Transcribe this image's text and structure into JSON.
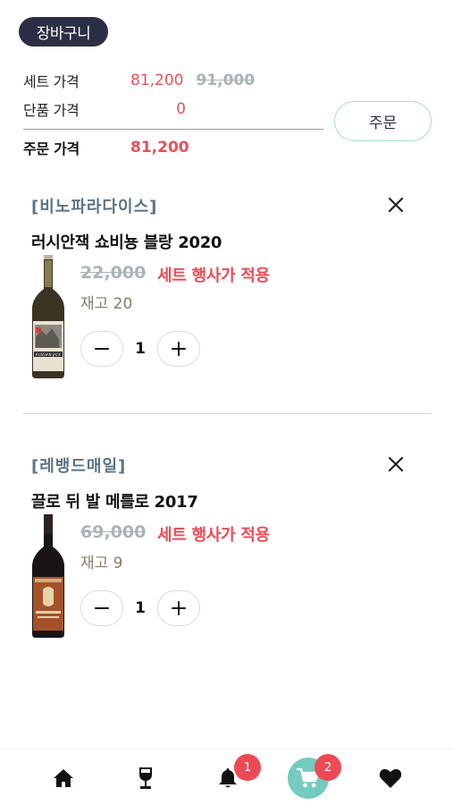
{
  "header": {
    "title": "장바구니"
  },
  "summary": {
    "set_price_label": "세트 가격",
    "set_price": "81,200",
    "set_price_original": "91,000",
    "unit_price_label": "단품 가격",
    "unit_price": "0",
    "total_label": "주문 가격",
    "total_price": "81,200"
  },
  "order_button": {
    "label": "주문"
  },
  "items": [
    {
      "winery": "[비노파라다이스]",
      "name": "러시안잭 쇼비뇽 블랑 2020",
      "original_price": "22,000",
      "promo": "세트 행사가 적용",
      "stock": "재고 20",
      "quantity": "1",
      "label_text": "RUSSIAN JACK"
    },
    {
      "winery": "[레뱅드매일]",
      "name": "끌로 뒤 발 메를로 2017",
      "original_price": "69,000",
      "promo": "세트 행사가 적용",
      "stock": "재고 9",
      "quantity": "1"
    }
  ],
  "nav": {
    "items": [
      "home-icon",
      "wine-glass-icon",
      "bell-icon",
      "cart-icon",
      "heart-icon"
    ],
    "bell_badge": "1",
    "cart_badge": "2",
    "accent": "#74cbbf",
    "badge_color": "#ee4a55"
  }
}
